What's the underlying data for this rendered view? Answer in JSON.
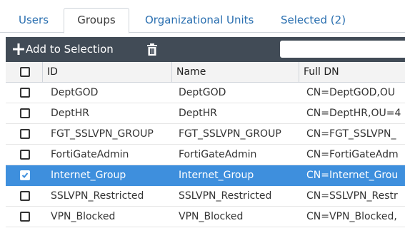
{
  "tabs": [
    {
      "label": "Users",
      "active": false
    },
    {
      "label": "Groups",
      "active": true
    },
    {
      "label": "Organizational Units",
      "active": false
    },
    {
      "label": "Selected (2)",
      "active": false
    }
  ],
  "toolbar": {
    "add_label": "Add to Selection",
    "search_value": "",
    "plus_icon": "plus-icon",
    "trash_icon": "trash-icon"
  },
  "table": {
    "columns": [
      "ID",
      "Name",
      "Full DN"
    ],
    "rows": [
      {
        "id": "DeptGOD",
        "name": "DeptGOD",
        "dn": "CN=DeptGOD,OU",
        "checked": false
      },
      {
        "id": "DeptHR",
        "name": "DeptHR",
        "dn": "CN=DeptHR,OU=4",
        "checked": false
      },
      {
        "id": "FGT_SSLVPN_GROUP",
        "name": "FGT_SSLVPN_GROUP",
        "dn": "CN=FGT_SSLVPN_",
        "checked": false
      },
      {
        "id": "FortiGateAdmin",
        "name": "FortiGateAdmin",
        "dn": "CN=FortiGateAdm",
        "checked": false
      },
      {
        "id": "Internet_Group",
        "name": "Internet_Group",
        "dn": "CN=Internet_Grou",
        "checked": true
      },
      {
        "id": "SSLVPN_Restricted",
        "name": "SSLVPN_Restricted",
        "dn": "CN=SSLVPN_Restr",
        "checked": false
      },
      {
        "id": "VPN_Blocked",
        "name": "VPN_Blocked",
        "dn": "CN=VPN_Blocked,",
        "checked": false
      }
    ]
  },
  "colors": {
    "toolbar_bg": "#414b56",
    "selected_row": "#3e8fdd",
    "tab_link": "#2a6fb0"
  }
}
